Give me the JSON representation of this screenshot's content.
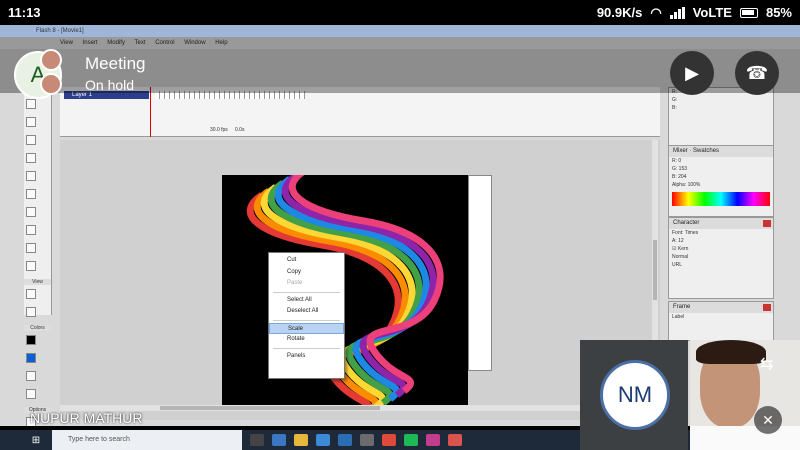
{
  "statusbar": {
    "time": "11:13",
    "net_speed": "90.9K/s",
    "carrier": "VoLTE",
    "battery": "85%"
  },
  "meeting": {
    "title": "Meeting",
    "status": "On hold",
    "avatar_letter": "A"
  },
  "flash": {
    "window_title": "Flash 8 - [Movie1]",
    "menu": [
      "View",
      "Insert",
      "Modify",
      "Text",
      "Control",
      "Window",
      "Help"
    ],
    "layer_name": "Layer 1",
    "fps": "30.0 fps",
    "elapsed": "0.0s",
    "toolbox_sections": [
      "View",
      "Colors",
      "Options"
    ],
    "panels": {
      "mixer": {
        "title": "Mixer",
        "tab2": "Swatches",
        "r": "0",
        "g": "153",
        "b": "204",
        "alpha": "100%"
      },
      "character": {
        "title": "Character",
        "font": "Times",
        "size": "12",
        "kern": "Kern",
        "normal": "Normal",
        "url": "URL"
      },
      "frame": {
        "title": "Frame",
        "label": "Label"
      }
    },
    "context_menu": [
      "Cut",
      "Copy",
      "Paste",
      "Select All",
      "Deselect All",
      "Scale",
      "Rotate",
      "Panels"
    ]
  },
  "taskbar": {
    "search_placeholder": "Type here to search"
  },
  "participants": {
    "speaker": "NUPUR MATHUR",
    "initials": "NM"
  },
  "colors": {
    "accent": "#4a6fa5",
    "selection": "#b9d4f2"
  }
}
